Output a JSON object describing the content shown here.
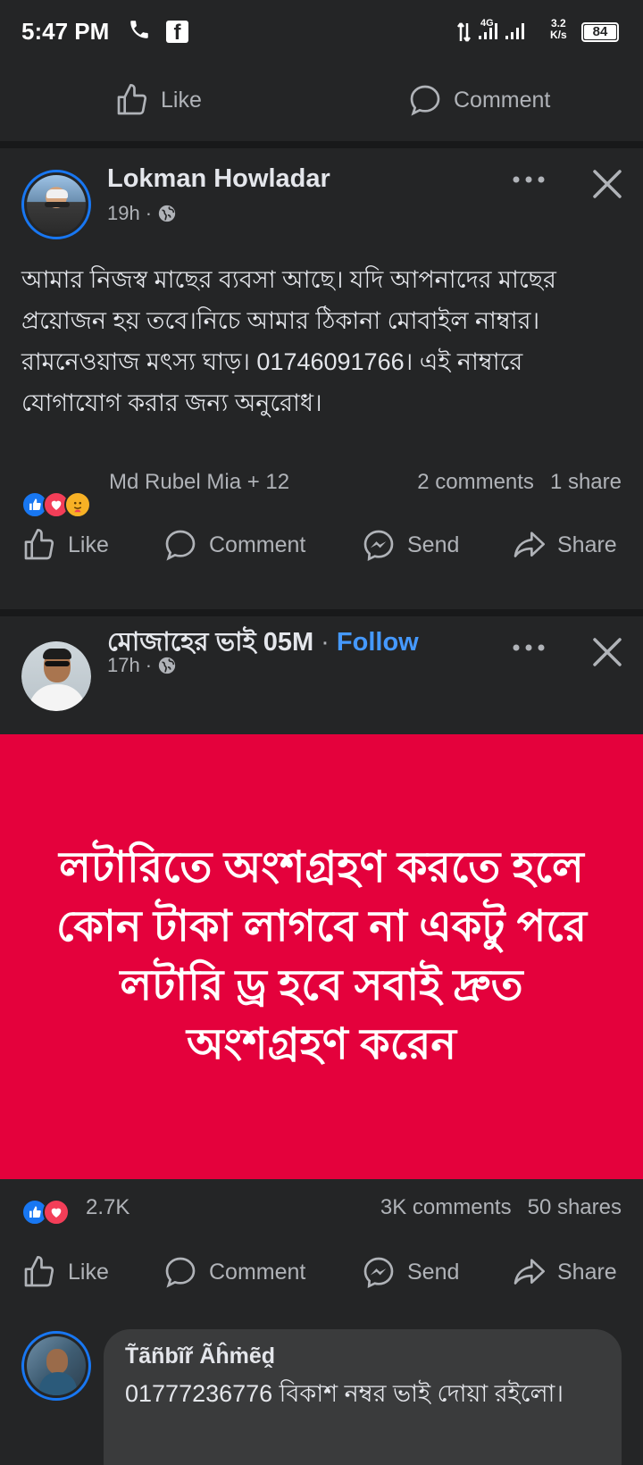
{
  "status_bar": {
    "time": "5:47 PM",
    "network": "4G",
    "speed_value": "3.2",
    "speed_unit": "K/s",
    "battery": "84"
  },
  "top_actions": {
    "like": "Like",
    "comment": "Comment"
  },
  "posts": [
    {
      "author": "Lokman Howladar",
      "time": "19h",
      "separator": "·",
      "text": "আমার নিজস্ব মাছের ব্যবসা আছে। যদি আপনাদের মাছের প্রয়োজন হয় তবে।নিচে আমার ঠিকানা মোবাইল নাম্বার।রামনেওয়াজ মৎস্য ঘাড়। 01746091766। এই নাম্বারে যোগাযোগ করার জন্য অনুরোধ।",
      "reactions_summary": "Md Rubel Mia + 12",
      "comments": "2 comments",
      "shares": "1 share",
      "actions": {
        "like": "Like",
        "comment": "Comment",
        "send": "Send",
        "share": "Share"
      }
    },
    {
      "author": "মোজাহের ভাই 05M",
      "author_separator": "·",
      "follow": "Follow",
      "time": "17h",
      "separator": "·",
      "banner_text": "লটারিতে অংশগ্রহণ করতে হলে কোন টাকা লাগবে না একটু পরে লটারি  ড্র হবে সবাই দ্রুত অংশগ্রহণ করেন",
      "banner_color": "#e4013c",
      "reactions_summary": "2.7K",
      "comments": "3K comments",
      "shares": "50 shares",
      "actions": {
        "like": "Like",
        "comment": "Comment",
        "send": "Send",
        "share": "Share"
      }
    }
  ],
  "comment": {
    "author": "T̃ãñbĩř Ãĥṁẽḓ",
    "text": "01777236776 বিকাশ নম্বর ভাই দোয়া রইলো।"
  },
  "colors": {
    "background": "#242526",
    "divider": "#18191a",
    "accent": "#1877f2",
    "follow": "#4599ff",
    "love": "#f33e58"
  }
}
